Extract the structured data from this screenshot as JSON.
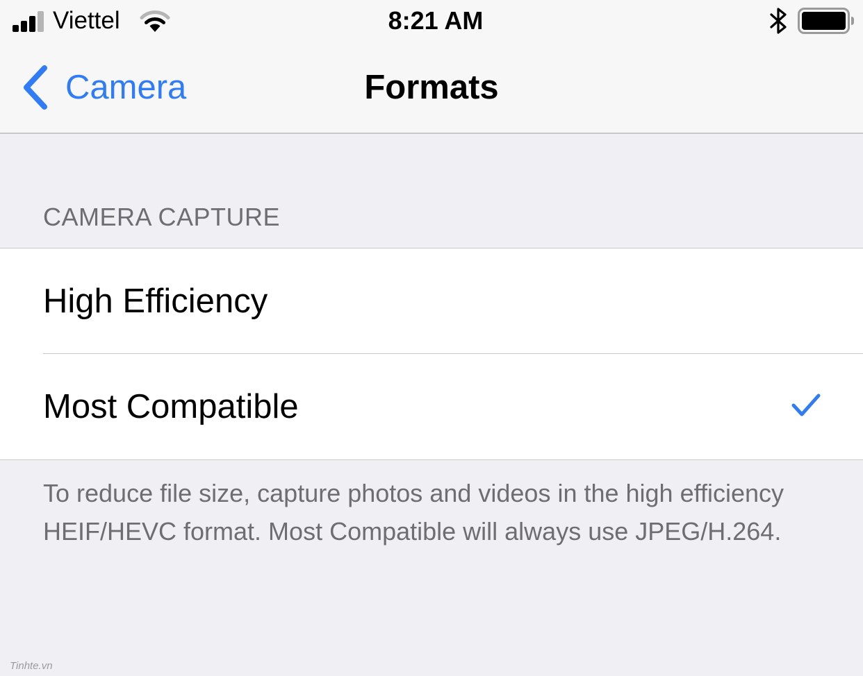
{
  "status_bar": {
    "carrier": "Viettel",
    "time": "8:21 AM",
    "signal_bars": 3,
    "signal_bars_total": 4
  },
  "nav": {
    "back_label": "Camera",
    "title": "Formats"
  },
  "section": {
    "header": "CAMERA CAPTURE",
    "options": [
      {
        "label": "High Efficiency",
        "selected": false
      },
      {
        "label": "Most Compatible",
        "selected": true
      }
    ],
    "footer": "To reduce file size, capture photos and videos in the high efficiency HEIF/HEVC format. Most Compatible will always use JPEG/H.264."
  },
  "watermark": "Tinhte.vn",
  "colors": {
    "accent": "#2f7cf6",
    "background": "#efeff4",
    "nav_background": "#f7f7f7",
    "secondary_text": "#6d6d72"
  },
  "icons": [
    "signal-icon",
    "wifi-icon",
    "bluetooth-icon",
    "battery-icon",
    "chevron-left-icon",
    "checkmark-icon"
  ]
}
